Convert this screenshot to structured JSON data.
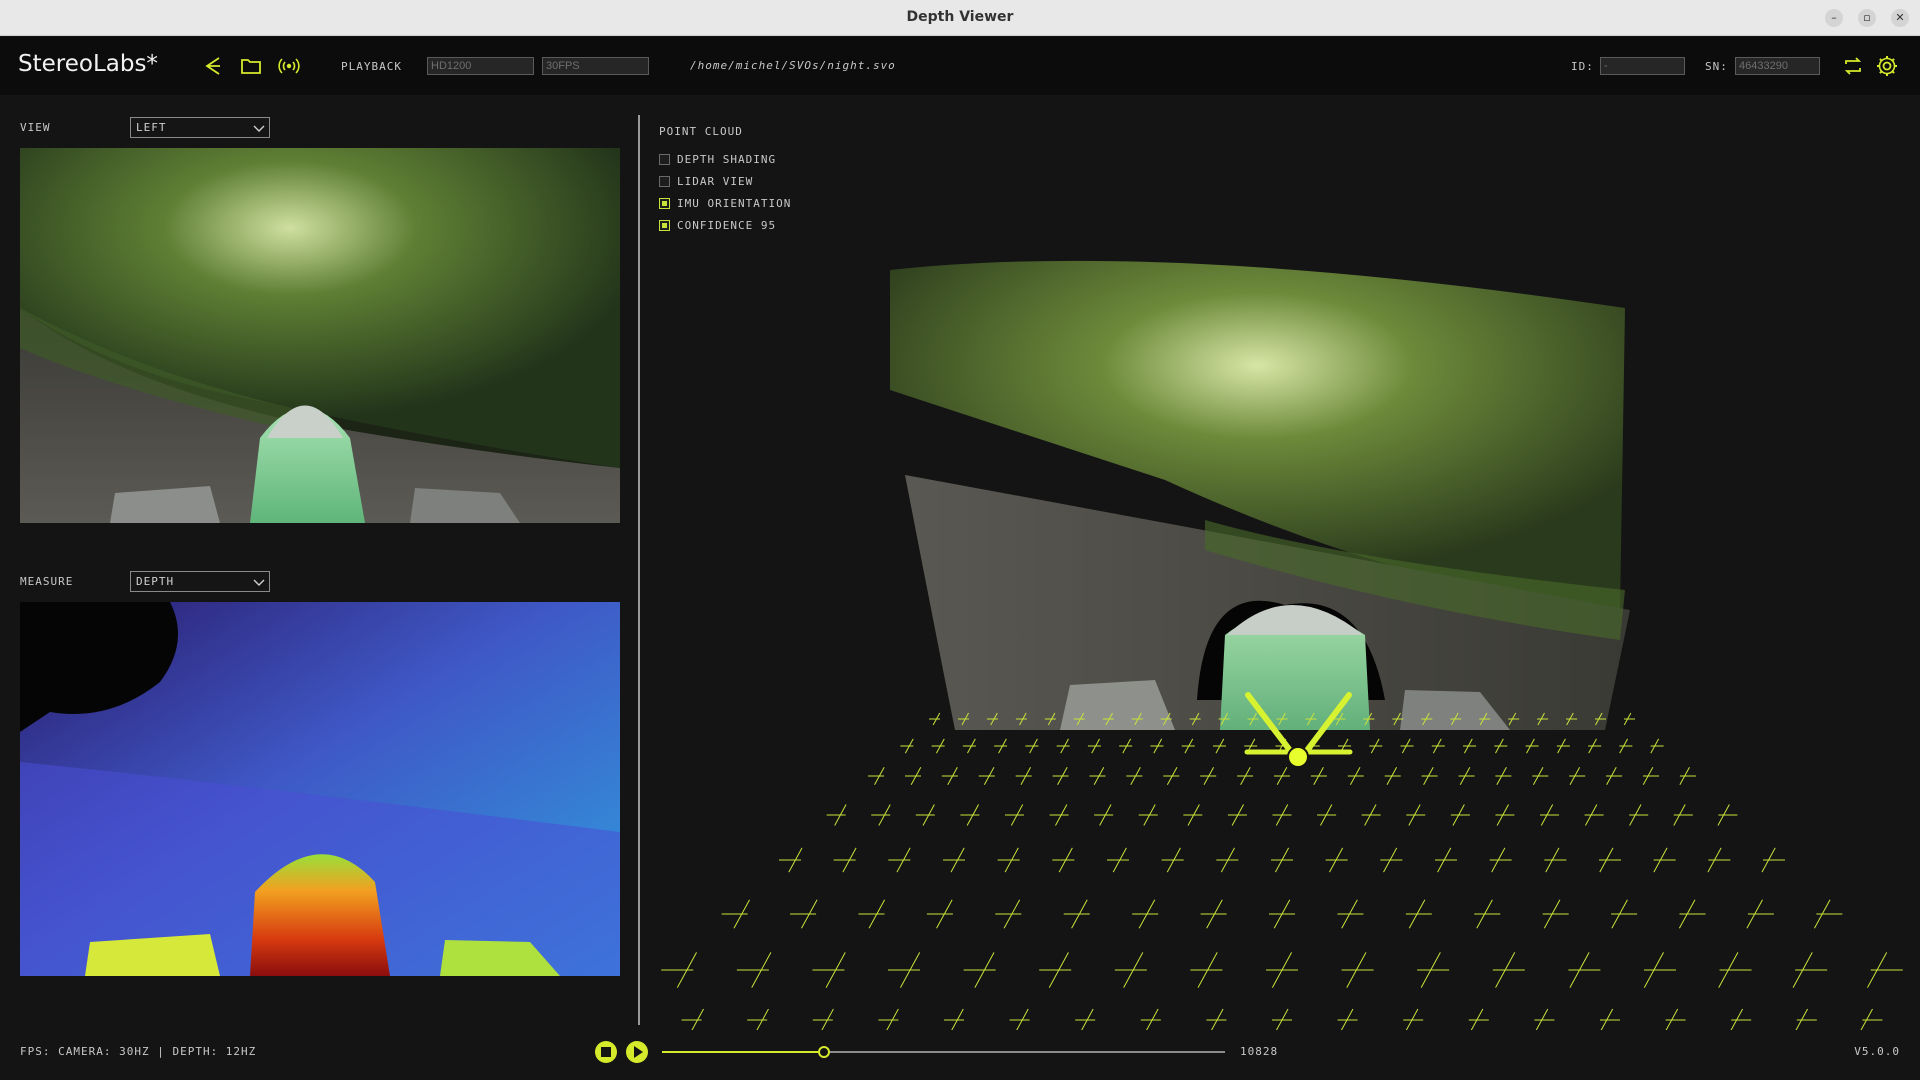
{
  "window": {
    "title": "Depth Viewer",
    "minimize": "–",
    "maximize": "▫",
    "close": "✕"
  },
  "toolbar": {
    "brand": "StereoLabs*",
    "mode_label": "PLAYBACK",
    "resolution_placeholder": "HD1200",
    "fps_placeholder": "30FPS",
    "file_path": "/home/michel/SVOs/night.svo",
    "id_label": "ID:",
    "id_value": "-",
    "sn_label": "SN:",
    "sn_value": "46433290",
    "accent": "#d6ea2c"
  },
  "left_panel": {
    "view_label": "VIEW",
    "view_selected": "LEFT",
    "measure_label": "MEASURE",
    "measure_selected": "DEPTH"
  },
  "point_cloud": {
    "label": "POINT CLOUD",
    "options": [
      {
        "label": "DEPTH SHADING",
        "checked": false
      },
      {
        "label": "LIDAR VIEW",
        "checked": false
      },
      {
        "label": "IMU ORIENTATION",
        "checked": true
      },
      {
        "label": "CONFIDENCE 95",
        "checked": true
      }
    ]
  },
  "status": {
    "fps_text": "FPS: CAMERA: 30HZ | DEPTH: 12HZ",
    "frame": "10828",
    "playback_progress": 0.29,
    "version": "V5.0.0"
  }
}
